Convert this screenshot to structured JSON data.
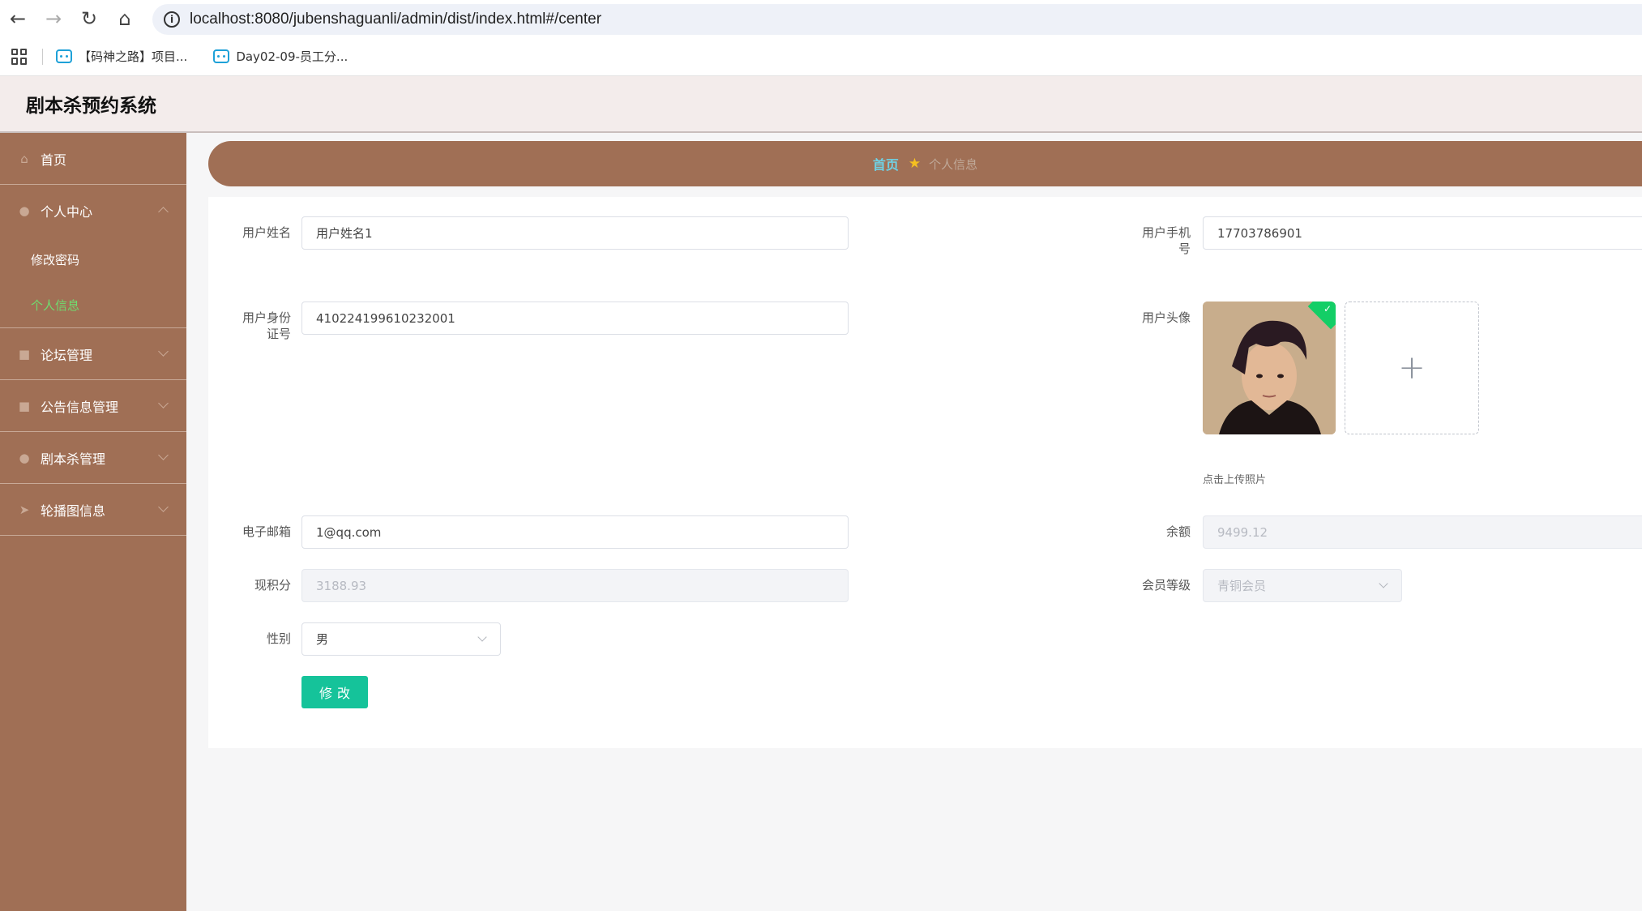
{
  "browser": {
    "url": "localhost:8080/jubenshaguanli/admin/dist/index.html#/center",
    "bookmarks": [
      "【码神之路】项目...",
      "Day02-09-员工分..."
    ]
  },
  "header": {
    "title": "剧本杀预约系统"
  },
  "sidebar": {
    "items": [
      {
        "label": "首页",
        "icon": "home-icon"
      },
      {
        "label": "个人中心",
        "icon": "user-icon",
        "expanded": true,
        "children": [
          {
            "label": "修改密码"
          },
          {
            "label": "个人信息",
            "active": true
          }
        ]
      },
      {
        "label": "论坛管理",
        "icon": "briefcase-icon"
      },
      {
        "label": "公告信息管理",
        "icon": "briefcase-icon"
      },
      {
        "label": "剧本杀管理",
        "icon": "location-icon"
      },
      {
        "label": "轮播图信息",
        "icon": "send-icon"
      }
    ]
  },
  "breadcrumb": {
    "home": "首页",
    "current": "个人信息"
  },
  "form": {
    "username": {
      "label": "用户姓名",
      "value": "用户姓名1"
    },
    "phone": {
      "label_line1": "用户手机",
      "label_line2": "号",
      "value": "17703786901"
    },
    "idcard": {
      "label_line1": "用户身份",
      "label_line2": "证号",
      "value": "410224199610232001"
    },
    "avatar": {
      "label": "用户头像",
      "upload_tip": "点击上传照片"
    },
    "email": {
      "label": "电子邮箱",
      "value": "1@qq.com"
    },
    "balance": {
      "label": "余额",
      "value": "9499.12"
    },
    "points": {
      "label": "现积分",
      "value": "3188.93"
    },
    "level": {
      "label": "会员等级",
      "value": "青铜会员"
    },
    "gender": {
      "label": "性别",
      "value": "男"
    },
    "submit_label": "修改"
  }
}
